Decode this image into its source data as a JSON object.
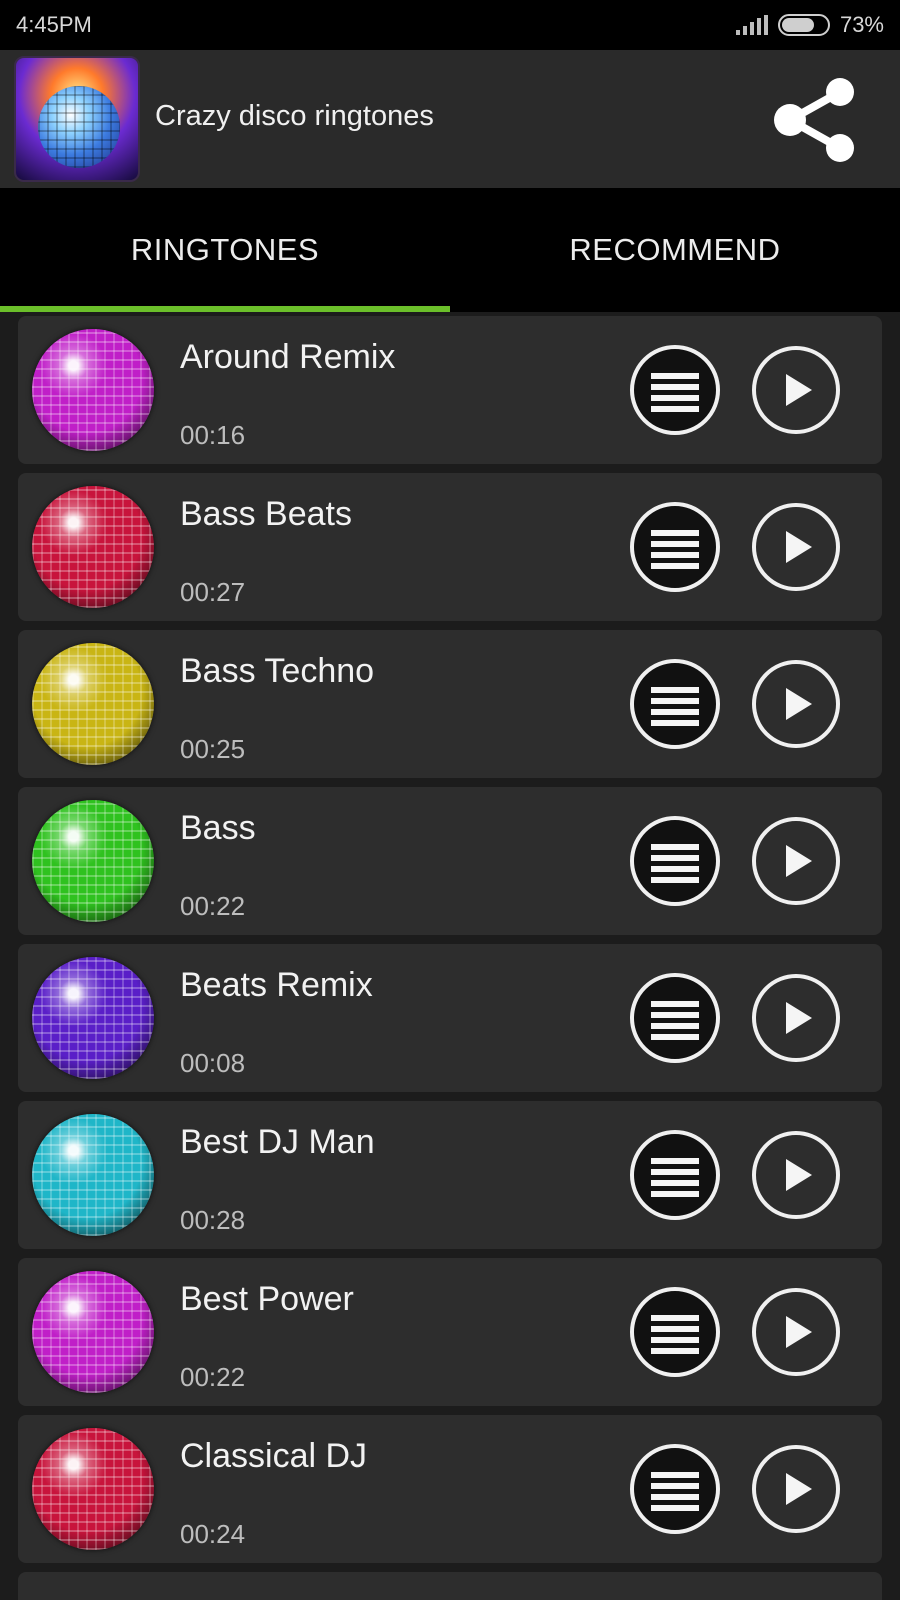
{
  "status_bar": {
    "time": "4:45PM",
    "battery_text": "73%",
    "battery_level": 0.73
  },
  "app_bar": {
    "title": "Crazy disco ringtones",
    "logo_icon": "disco-headphones-logo",
    "share_icon": "share-icon"
  },
  "tabs": [
    {
      "label": "RINGTONES",
      "selected": true
    },
    {
      "label": "RECOMMEND",
      "selected": false
    }
  ],
  "accent_color": "#6bbf2a",
  "ringtones": [
    {
      "title": "Around Remix",
      "duration": "00:16",
      "ball_color": "#c01fc8"
    },
    {
      "title": "Bass Beats",
      "duration": "00:27",
      "ball_color": "#c8143c"
    },
    {
      "title": "Bass Techno",
      "duration": "00:25",
      "ball_color": "#c9b514"
    },
    {
      "title": "Bass",
      "duration": "00:22",
      "ball_color": "#2fc21f"
    },
    {
      "title": "Beats Remix",
      "duration": "00:08",
      "ball_color": "#5a1fc8"
    },
    {
      "title": "Best DJ Man",
      "duration": "00:28",
      "ball_color": "#1fb6c8"
    },
    {
      "title": "Best Power",
      "duration": "00:22",
      "ball_color": "#c01fc8"
    },
    {
      "title": "Classical DJ",
      "duration": "00:24",
      "ball_color": "#c8143c"
    }
  ],
  "row_icons": {
    "menu": "menu-lines-icon",
    "play": "play-icon"
  }
}
